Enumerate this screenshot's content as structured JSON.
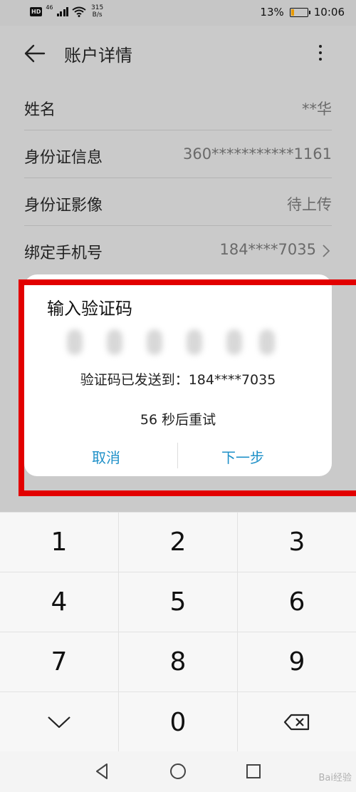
{
  "status_bar": {
    "hd": "HD",
    "net": "46",
    "speed_value": "315",
    "speed_unit": "B/s",
    "battery_percent": "13%",
    "time": "10:06"
  },
  "header": {
    "title": "账户详情"
  },
  "details": [
    {
      "label": "姓名",
      "value": "**华"
    },
    {
      "label": "身份证信息",
      "value": "360***********1161"
    },
    {
      "label": "身份证影像",
      "value": "待上传"
    },
    {
      "label": "绑定手机号",
      "value": "184****7035"
    }
  ],
  "dialog": {
    "title": "输入验证码",
    "sent_text": "验证码已发送到：184****7035",
    "retry_text": "56 秒后重试",
    "cancel_label": "取消",
    "next_label": "下一步"
  },
  "keypad": {
    "keys": [
      "1",
      "2",
      "3",
      "4",
      "5",
      "6",
      "7",
      "8",
      "9",
      "",
      "0",
      ""
    ]
  },
  "watermark": "Bai经验"
}
